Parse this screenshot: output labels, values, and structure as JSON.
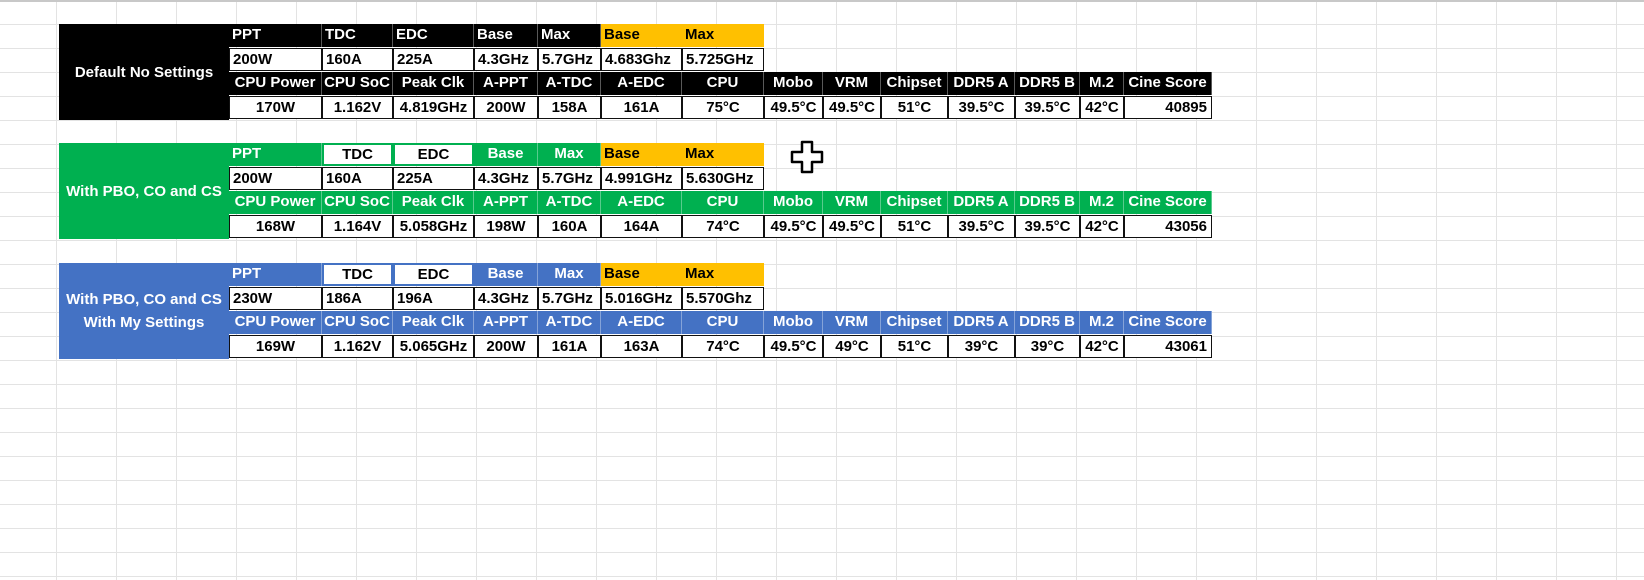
{
  "sections": [
    {
      "theme": "black",
      "label": [
        "Default No Settings"
      ],
      "header1": [
        "PPT",
        "TDC",
        "EDC",
        "Base",
        "Max",
        "Base",
        "Max"
      ],
      "values1": [
        "200W",
        "160A",
        "225A",
        "4.3GHz",
        "5.7GHz",
        "4.683Ghz",
        "5.725GHz"
      ],
      "header2": [
        "CPU Power",
        "CPU SoC",
        "Peak Clk",
        "A-PPT",
        "A-TDC",
        "A-EDC",
        "CPU",
        "Mobo",
        "VRM",
        "Chipset",
        "DDR5 A",
        "DDR5 B",
        "M.2",
        "Cine Score"
      ],
      "values2": [
        "170W",
        "1.162V",
        "4.819GHz",
        "200W",
        "158A",
        "161A",
        "75°C",
        "49.5°C",
        "49.5°C",
        "51°C",
        "39.5°C",
        "39.5°C",
        "42°C",
        "40895"
      ]
    },
    {
      "theme": "green",
      "label": [
        "With PBO, CO and CS"
      ],
      "header1": [
        "PPT",
        "TDC",
        "EDC",
        "Base",
        "Max",
        "Base",
        "Max"
      ],
      "values1": [
        "200W",
        "160A",
        "225A",
        "4.3GHz",
        "5.7GHz",
        "4.991GHz",
        "5.630GHz"
      ],
      "header2": [
        "CPU Power",
        "CPU SoC",
        "Peak Clk",
        "A-PPT",
        "A-TDC",
        "A-EDC",
        "CPU",
        "Mobo",
        "VRM",
        "Chipset",
        "DDR5 A",
        "DDR5 B",
        "M.2",
        "Cine Score"
      ],
      "values2": [
        "168W",
        "1.164V",
        "5.058GHz",
        "198W",
        "160A",
        "164A",
        "74°C",
        "49.5°C",
        "49.5°C",
        "51°C",
        "39.5°C",
        "39.5°C",
        "42°C",
        "43056"
      ]
    },
    {
      "theme": "blue",
      "label": [
        "With PBO, CO and CS",
        "With My Settings"
      ],
      "header1": [
        "PPT",
        "TDC",
        "EDC",
        "Base",
        "Max",
        "Base",
        "Max"
      ],
      "values1": [
        "230W",
        "186A",
        "196A",
        "4.3GHz",
        "5.7GHz",
        "5.016GHz",
        "5.570Ghz"
      ],
      "header2": [
        "CPU Power",
        "CPU SoC",
        "Peak Clk",
        "A-PPT",
        "A-TDC",
        "A-EDC",
        "CPU",
        "Mobo",
        "VRM",
        "Chipset",
        "DDR5 A",
        "DDR5 B",
        "M.2",
        "Cine Score"
      ],
      "values2": [
        "169W",
        "1.162V",
        "5.065GHz",
        "200W",
        "161A",
        "163A",
        "74°C",
        "49.5°C",
        "49°C",
        "51°C",
        "39°C",
        "39°C",
        "42°C",
        "43061"
      ]
    }
  ],
  "colors": {
    "black": "#000000",
    "green": "#00b050",
    "blue": "#4472c4",
    "orange": "#ffc000"
  },
  "cursor_icon": "move-cursor-icon"
}
